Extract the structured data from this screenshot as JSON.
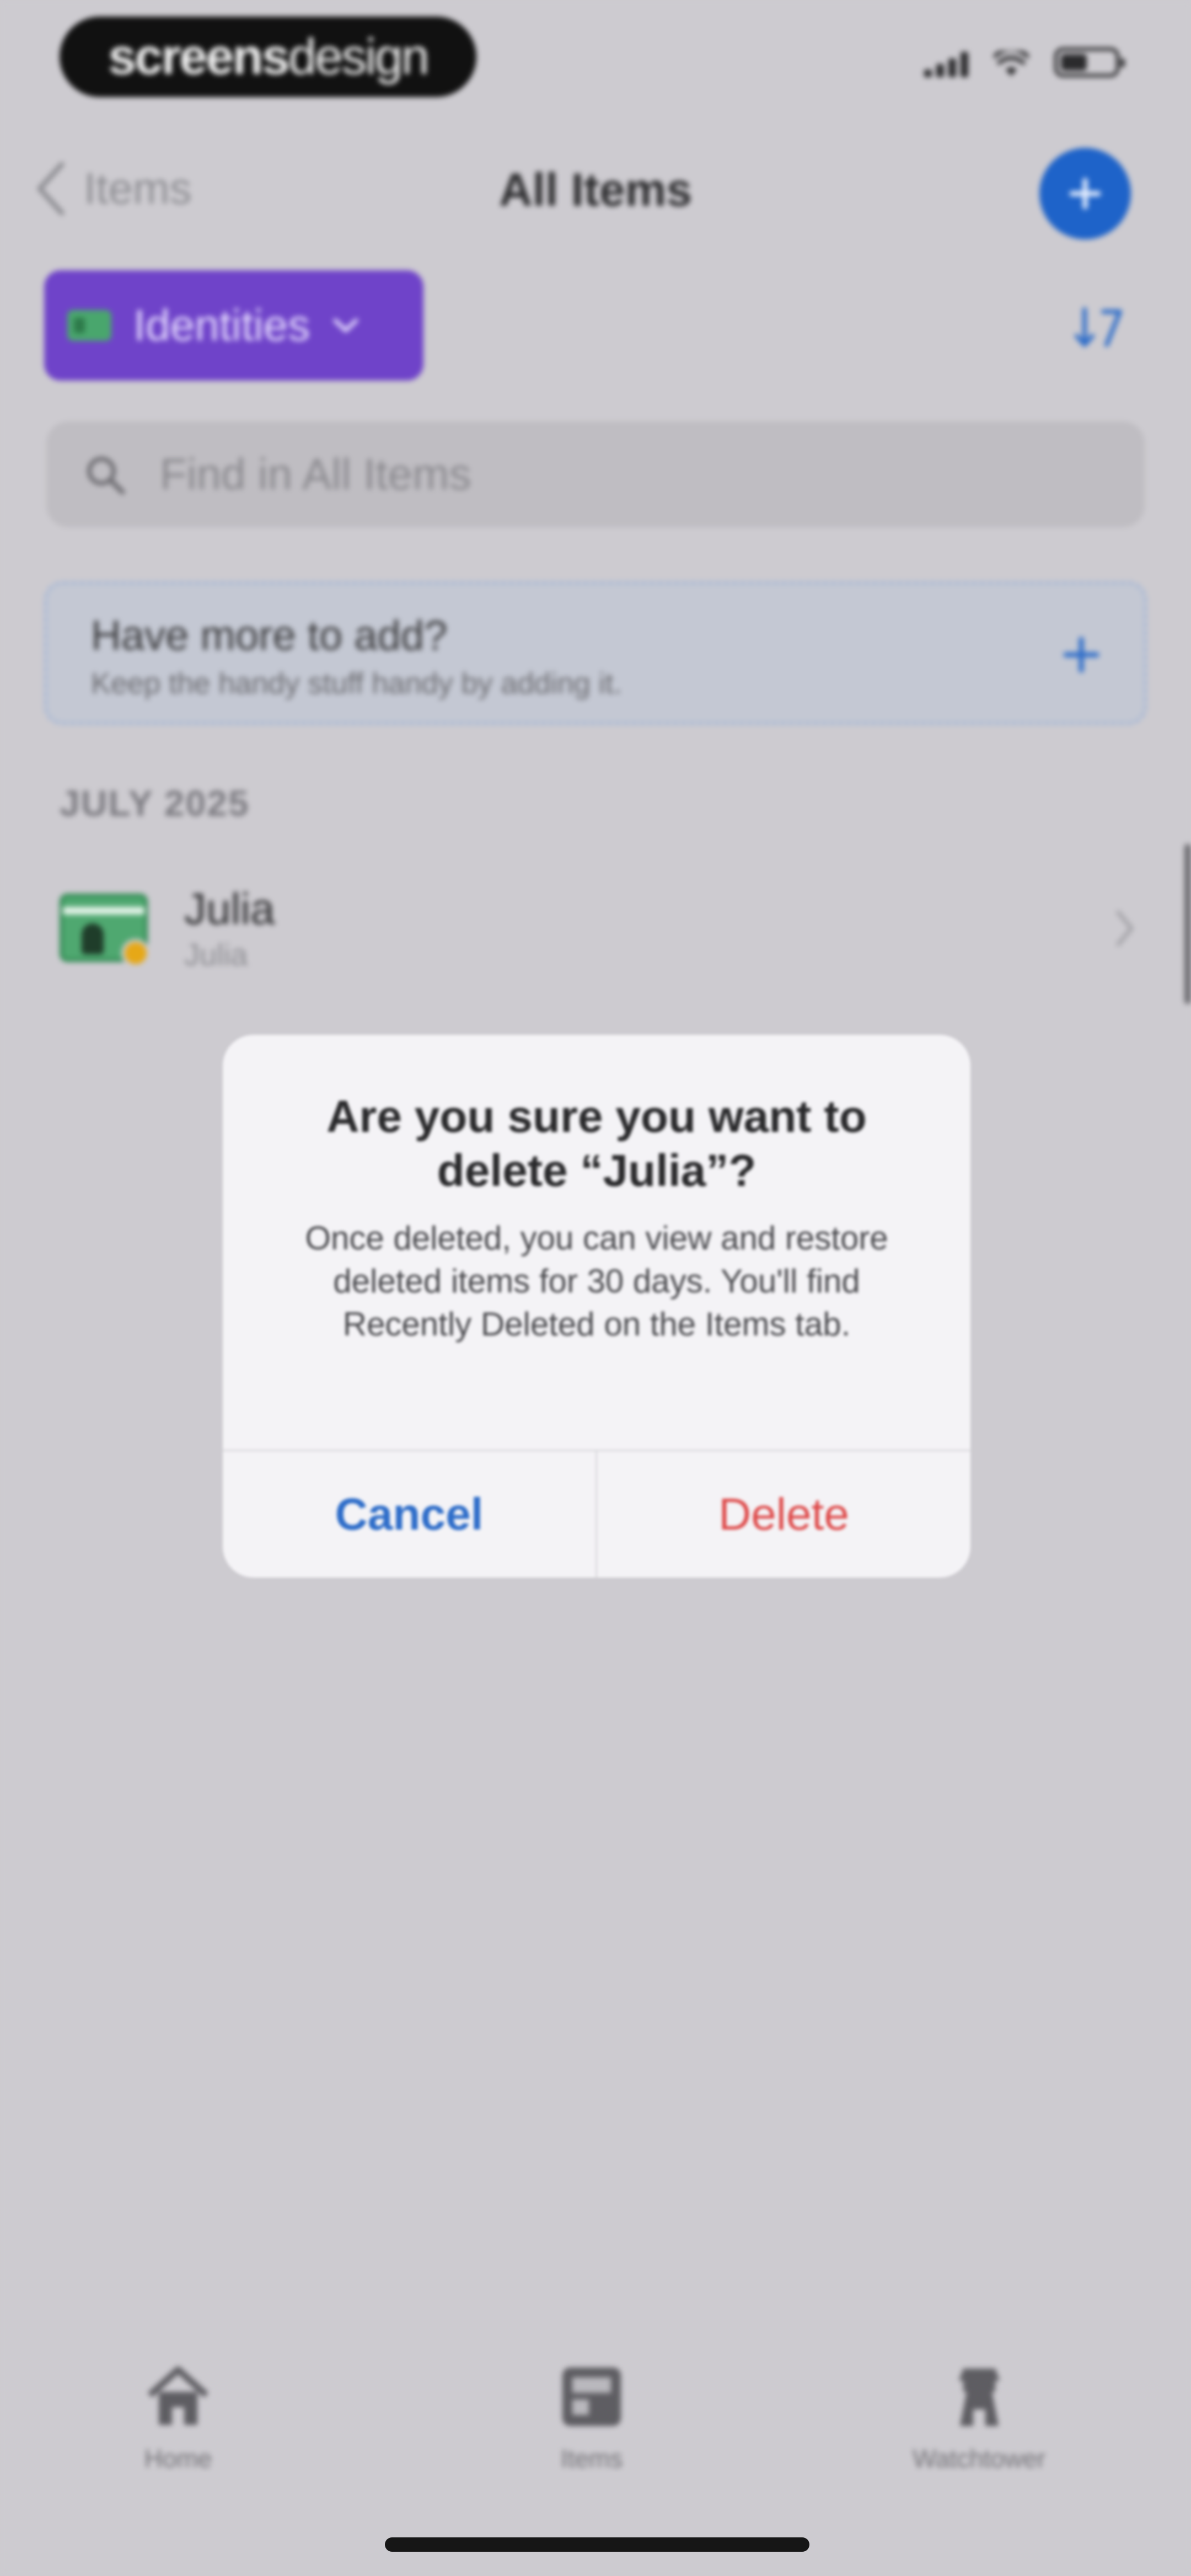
{
  "status_bar": {
    "brand_bold": "screens",
    "brand_light": "design"
  },
  "nav": {
    "back_label": "Items",
    "title": "All Items"
  },
  "filter": {
    "label": "Identities"
  },
  "search": {
    "placeholder": "Find in All Items"
  },
  "promo": {
    "title": "Have more to add?",
    "subtitle": "Keep the handy stuff handy by adding it."
  },
  "section": {
    "header": "JULY 2025"
  },
  "items": [
    {
      "title": "Julia",
      "subtitle": "Julia"
    }
  ],
  "dialog": {
    "title": "Are you sure you want to delete “Julia”?",
    "message": "Once deleted, you can view and restore deleted items for 30 days. You'll find Recently Deleted on the Items tab.",
    "cancel": "Cancel",
    "delete": "Delete"
  },
  "tabs": [
    {
      "label": "Home",
      "icon": "house-icon"
    },
    {
      "label": "Items",
      "icon": "items-icon"
    },
    {
      "label": "Watchtower",
      "icon": "watchtower-icon"
    }
  ],
  "colors": {
    "accent": "#1e63c9",
    "filter_purple": "#6f43c9",
    "delete_red": "#de4a4a",
    "cancel_blue": "#2e6dc9"
  }
}
